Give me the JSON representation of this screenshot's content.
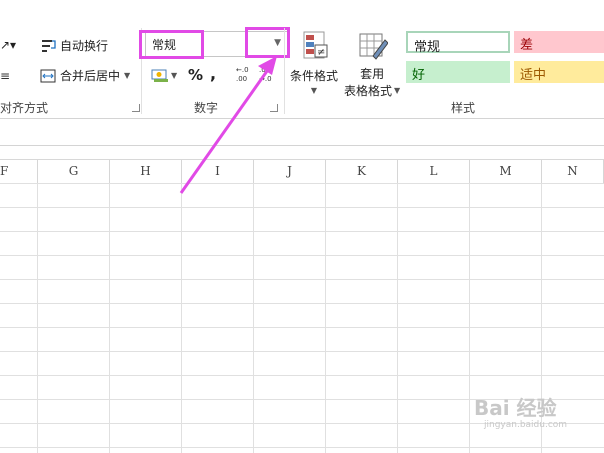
{
  "ribbon": {
    "alignment": {
      "wrap_text": "自动换行",
      "merge_center": "合并后居中",
      "group_label": "对齐方式"
    },
    "number": {
      "format_value": "常规",
      "percent_symbol": "%",
      "comma_symbol": ",",
      "group_label": "数字"
    },
    "styles": {
      "conditional_formatting": "条件格式",
      "table_format_line1": "套用",
      "table_format_line2": "表格格式",
      "group_label": "样式",
      "cells": [
        {
          "label": "常规",
          "bg": "#ffffff",
          "border": "#7fbf9f"
        },
        {
          "label": "差",
          "bg": "#ffc7ce",
          "color": "#9c0006"
        },
        {
          "label": "好",
          "bg": "#c6efce",
          "color": "#006100"
        },
        {
          "label": "适中",
          "bg": "#ffeb9c",
          "color": "#9c5700"
        }
      ]
    }
  },
  "columns": [
    "F",
    "G",
    "H",
    "I",
    "J",
    "K",
    "L",
    "M",
    "N"
  ],
  "watermark": {
    "main": "Bai 经验",
    "sub": "jingyan.baidu.com"
  },
  "colors": {
    "highlight": "#e14ae6"
  }
}
